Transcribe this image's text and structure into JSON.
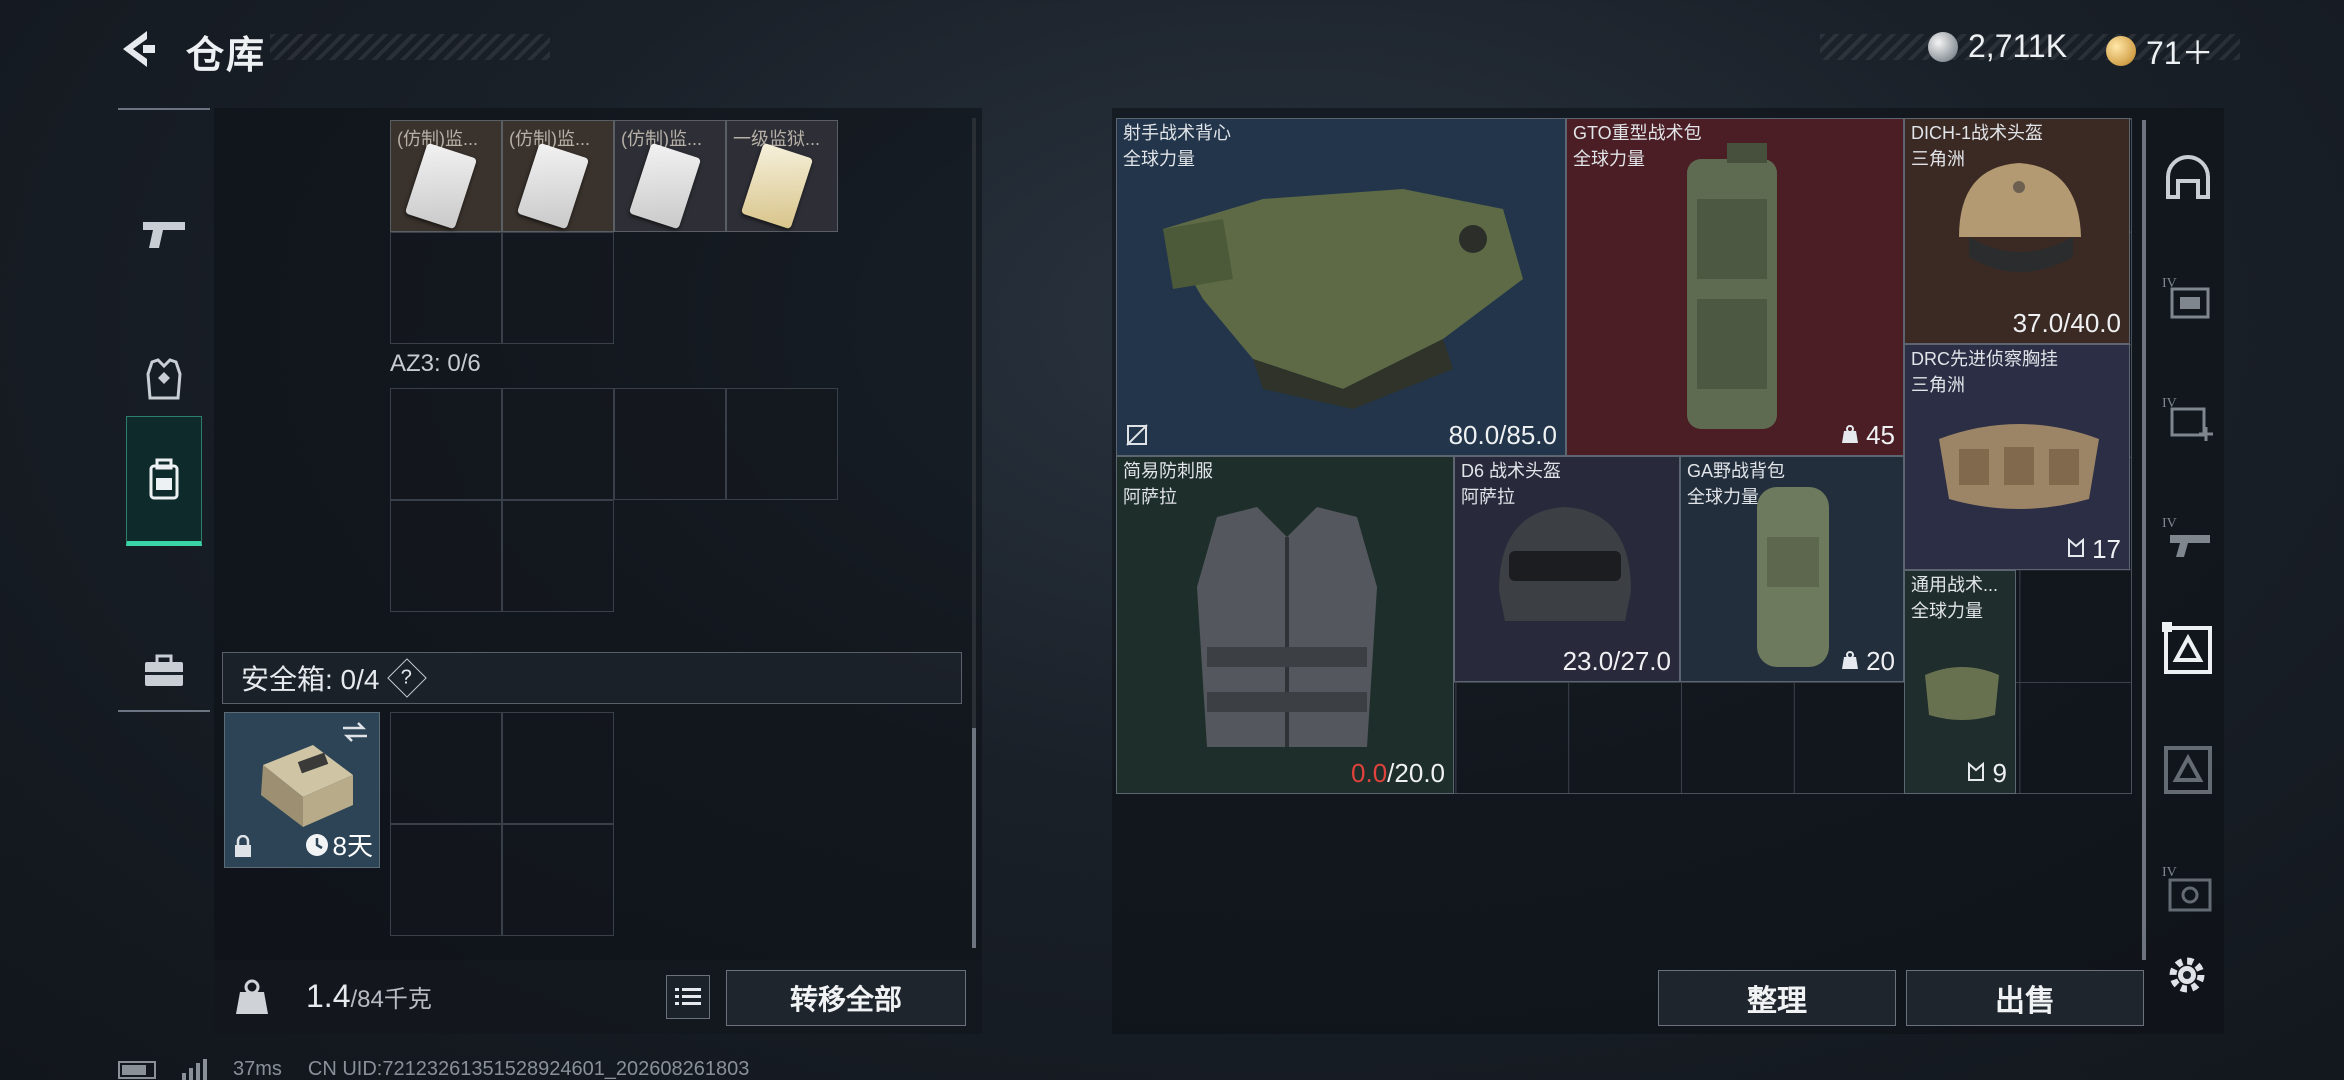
{
  "header": {
    "title": "仓库",
    "currency_1": "2,711K",
    "currency_2": "71＋"
  },
  "left_nav": {
    "items": [
      "weapon",
      "armor",
      "backpack",
      "case"
    ],
    "active": "backpack"
  },
  "left_panel": {
    "top_slots": [
      "(仿制)监...",
      "(仿制)监...",
      "(仿制)监...",
      "一级监狱..."
    ],
    "az3_label": "AZ3: 0/6",
    "safe_box_label": "安全箱: 0/4",
    "safe_box_help": "?",
    "safe_box_days": "8天",
    "weight": "1.4",
    "weight_max": "/84千克",
    "transfer_all": "转移全部"
  },
  "stash": {
    "items": [
      {
        "name": "射手战术背心",
        "sub": "全球力量",
        "value": "80.0/85.0",
        "color": "#22354a"
      },
      {
        "name": "GTO重型战术包",
        "sub": "全球力量",
        "value": "45",
        "color": "#4a1e24"
      },
      {
        "name": "DICH-1战术头盔",
        "sub": "三角洲",
        "value": "37.0/40.0",
        "color": "#3b2a24"
      },
      {
        "name": "DRC先进侦察胸挂",
        "sub": "三角洲",
        "value": "17",
        "color": "#2b2e44"
      },
      {
        "name": "简易防刺服",
        "sub": "阿萨拉",
        "value_red": "0.0",
        "value": "/20.0",
        "color": "#1e2e2a"
      },
      {
        "name": "D6 战术头盔",
        "sub": "阿萨拉",
        "value": "23.0/27.0",
        "color": "#282a3c"
      },
      {
        "name": "GA野战背包",
        "sub": "全球力量",
        "value": "20",
        "color": "#222e3c"
      },
      {
        "name": "通用战术...",
        "sub": "全球力量",
        "value": "9",
        "color": "#1f2d2c"
      }
    ],
    "sort_label": "整理",
    "sell_label": "出售"
  },
  "footer": {
    "ping": "37ms",
    "uid": "CN UID:7212326135152892460​1_202608261803"
  },
  "colors": {
    "accent": "#39d5a6",
    "red_value": "#e0423c"
  }
}
